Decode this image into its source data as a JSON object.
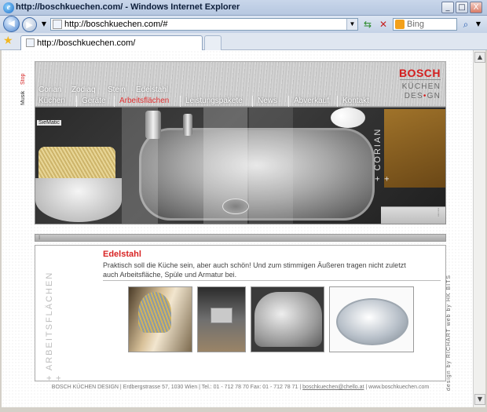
{
  "window": {
    "title": "http://boschkuechen.com/ - Windows Internet Explorer",
    "minimize": "_",
    "maximize": "□",
    "close": "X"
  },
  "toolbar": {
    "back": "◀",
    "forward": "▶",
    "address": "http://boschkuechen.com/#",
    "search_placeholder": "Bing"
  },
  "tab": {
    "label": "http://boschkuechen.com/"
  },
  "side_left": {
    "musik": "Musik",
    "stop": "Stop"
  },
  "logo": {
    "brand": "BOSCH",
    "line1": "KÜCHEN",
    "line2_a": "DES",
    "line2_dot": "•",
    "line2_b": "GN"
  },
  "subnav": [
    "Corian",
    "Zodiaq",
    "Stein",
    "Edelstahl"
  ],
  "mainnav": [
    "Küchen",
    "Geräte",
    "Arbeitsflächen",
    "Leistungspakete",
    "News",
    "Abverkauf",
    "Kontakt"
  ],
  "mainnav_active": "Arbeitsflächen",
  "hero": {
    "vertical_label": "+ CORIAN +",
    "small_sign": "SieMatic"
  },
  "content": {
    "side_label": "+ ARBEITSFLÄCHEN +",
    "heading": "Edelstahl",
    "intro": "Praktisch soll die Küche sein, aber auch schön! Und zum stimmigen Äußeren tragen nicht zuletzt auch Arbeitsfläche, Spüle und Armatur bei.",
    "credit": "design by RICHART   web by HK BITS"
  },
  "footer": {
    "text": "BOSCH KÜCHEN DESIGN | Erdbergstrasse 57, 1030 Wien | Tel.: 01 - 712 78 70 Fax: 01 - 712 78 71 |",
    "email": "boschkuechen@chello.at",
    "site": "| www.boschkuechen.com"
  }
}
